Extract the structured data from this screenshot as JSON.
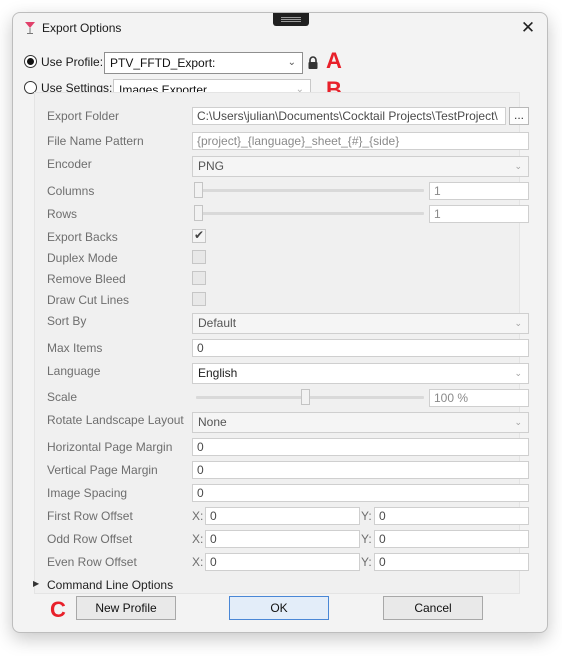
{
  "window": {
    "title": "Export Options",
    "close_glyph": "✕"
  },
  "profile": {
    "use_profile_label": "Use Profile:",
    "profile_value": "PTV_FFTD_Export:",
    "use_settings_label": "Use Settings:",
    "settings_value": "Images Exporter",
    "selected": "use_profile"
  },
  "annotations": {
    "a": "A",
    "b": "B",
    "c": "C",
    "color": "#e8202a"
  },
  "settings": {
    "export_folder": {
      "label": "Export Folder",
      "value": "C:\\Users\\julian\\Documents\\Cocktail Projects\\TestProject\\",
      "browse": "..."
    },
    "file_name_pattern": {
      "label": "File Name Pattern",
      "value": "{project}_{language}_sheet_{#}_{side}"
    },
    "encoder": {
      "label": "Encoder",
      "value": "PNG"
    },
    "columns": {
      "label": "Columns",
      "value": "1",
      "slider_fraction": 0.0
    },
    "rows": {
      "label": "Rows",
      "value": "1",
      "slider_fraction": 0.0
    },
    "export_backs": {
      "label": "Export Backs",
      "checked": true
    },
    "duplex_mode": {
      "label": "Duplex Mode",
      "checked": false
    },
    "remove_bleed": {
      "label": "Remove Bleed",
      "checked": false
    },
    "draw_cut_lines": {
      "label": "Draw Cut Lines",
      "checked": false
    },
    "sort_by": {
      "label": "Sort By",
      "value": "Default"
    },
    "max_items": {
      "label": "Max Items",
      "value": "0"
    },
    "language": {
      "label": "Language",
      "value": "English"
    },
    "scale": {
      "label": "Scale",
      "value": "100 %",
      "slider_fraction": 0.5
    },
    "rotate_landscape": {
      "label": "Rotate Landscape Layout",
      "value": "None"
    },
    "horizontal_margin": {
      "label": "Horizontal Page Margin",
      "value": "0"
    },
    "vertical_margin": {
      "label": "Vertical Page Margin",
      "value": "0"
    },
    "image_spacing": {
      "label": "Image Spacing",
      "value": "0"
    },
    "first_row_offset": {
      "label": "First Row Offset",
      "x_label": "X:",
      "x": "0",
      "y_label": "Y:",
      "y": "0"
    },
    "odd_row_offset": {
      "label": "Odd Row Offset",
      "x_label": "X:",
      "x": "0",
      "y_label": "Y:",
      "y": "0"
    },
    "even_row_offset": {
      "label": "Even Row Offset",
      "x_label": "X:",
      "x": "0",
      "y_label": "Y:",
      "y": "0"
    },
    "command_line_options": {
      "label": "Command Line Options",
      "expanded": false
    }
  },
  "buttons": {
    "new_profile": "New Profile",
    "ok": "OK",
    "cancel": "Cancel"
  },
  "glyphs": {
    "dropdown": "⌄",
    "expander": "▶",
    "lock": "lock-icon"
  }
}
